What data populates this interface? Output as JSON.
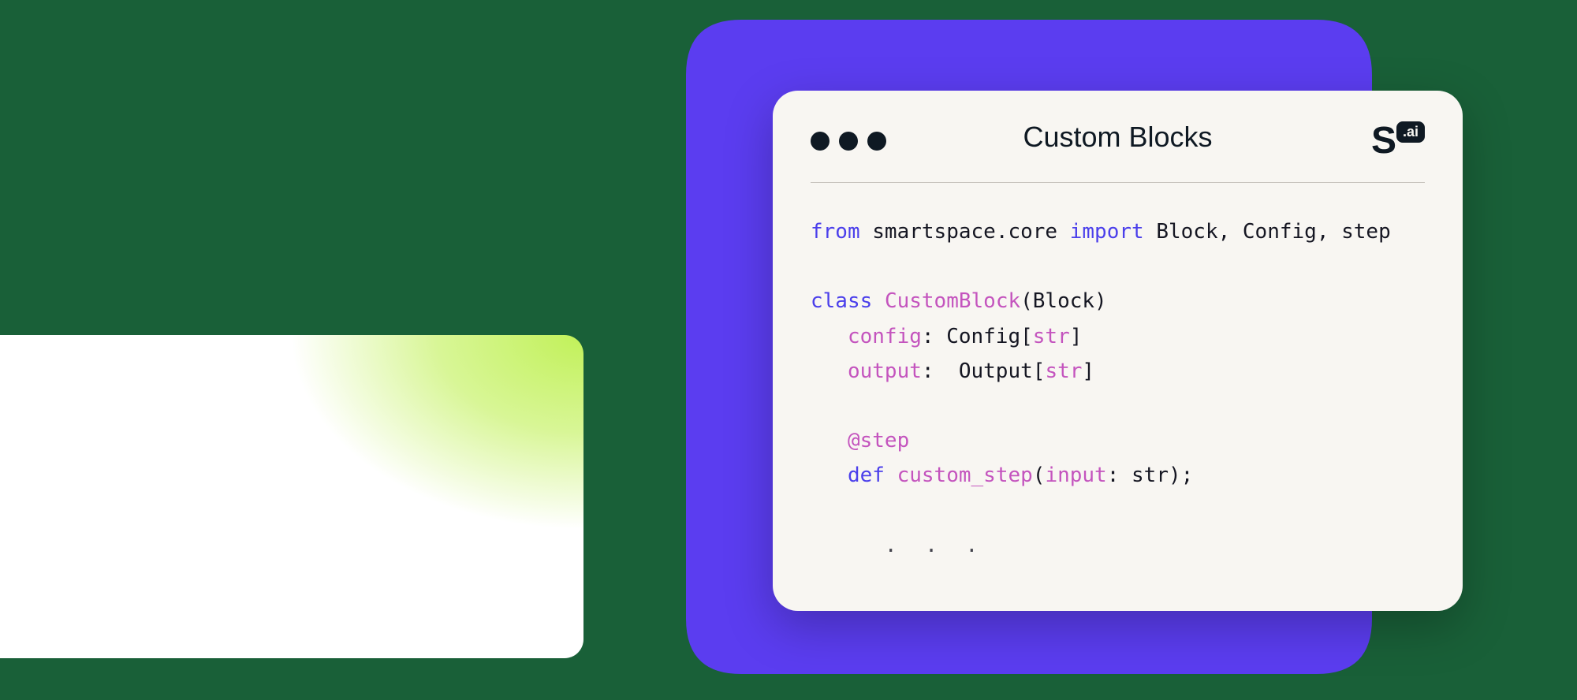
{
  "window": {
    "title": "Custom Blocks",
    "logo": {
      "letter": "S",
      "badge": ".ai"
    }
  },
  "code": {
    "line1": {
      "from": "from",
      "module": "smartspace.core",
      "import": "import",
      "names": "Block, Config, step"
    },
    "line2": {
      "class_kw": "class",
      "classname": "CustomBlock",
      "parent": "(Block)"
    },
    "line3": {
      "attr": "config",
      "type_prefix": ": Config[",
      "type_param": "str",
      "type_suffix": "]"
    },
    "line4": {
      "attr": "output",
      "type_prefix": ":  Output[",
      "type_param": "str",
      "type_suffix": "]"
    },
    "line5": {
      "decorator": "@step"
    },
    "line6": {
      "def_kw": "def",
      "funcname": "custom_step",
      "paren_open": "(",
      "param": "input",
      "param_sep": ": ",
      "param_type": "str",
      "paren_close": ");"
    },
    "line7": {
      "ellipsis": ". . ."
    }
  }
}
